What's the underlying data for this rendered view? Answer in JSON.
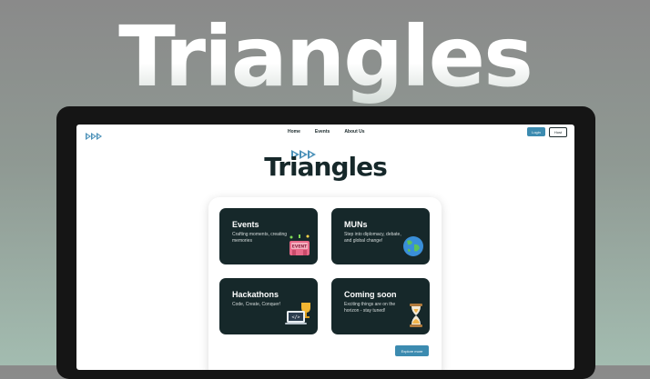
{
  "hero": {
    "title": "Triangles"
  },
  "nav": {
    "links": [
      "Home",
      "Events",
      "About Us"
    ],
    "login_label": "Login",
    "host_label": "Host"
  },
  "brand": {
    "name": "Triangles"
  },
  "cards": [
    {
      "title": "Events",
      "description": "Crafting moments, creating memories",
      "icon": "event-sign-icon"
    },
    {
      "title": "MUNs",
      "description": "Step into diplomacy, debate, and global change!",
      "icon": "globe-icon"
    },
    {
      "title": "Hackathons",
      "description": "Code, Create, Conquer!",
      "icon": "trophy-laptop-icon"
    },
    {
      "title": "Coming soon",
      "description": "Exciting things are on the horizon - stay tuned!",
      "icon": "hourglass-icon"
    }
  ],
  "icon_labels": {
    "event_sign": "EVENT"
  },
  "explore_label": "Explore more",
  "colors": {
    "accent": "#3c8bb0",
    "dark": "#16282a",
    "arrow": "#4a90b8"
  }
}
